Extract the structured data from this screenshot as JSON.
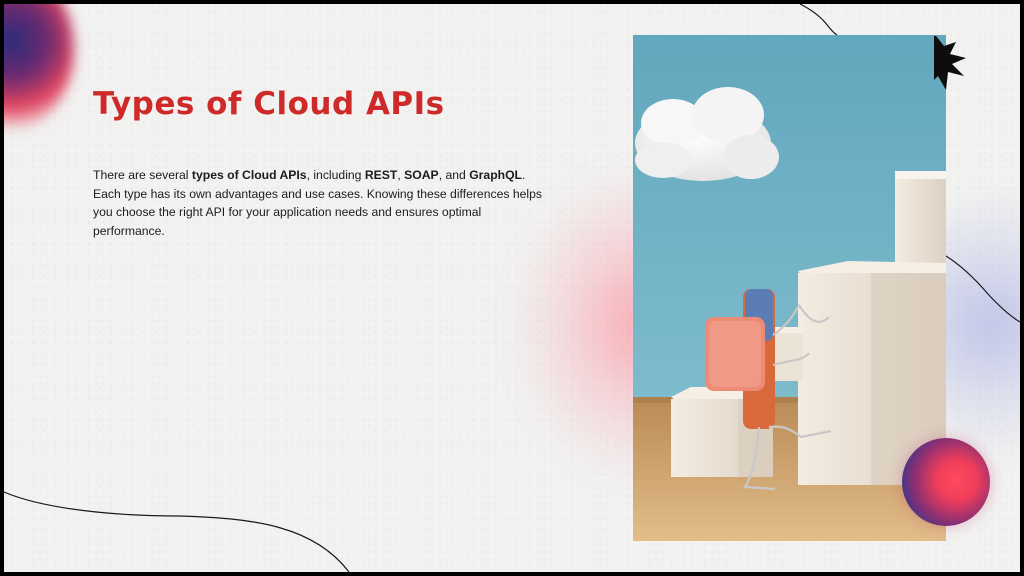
{
  "slide": {
    "title": "Types of Cloud APIs",
    "body": {
      "t1": "There are several ",
      "b1": "types of Cloud APIs",
      "t2": ", including ",
      "b2": "REST",
      "t3": ", ",
      "b3": "SOAP",
      "t4": ", and ",
      "b4": "GraphQL",
      "t5": ". Each type has its own advantages and use cases. Knowing these differences helps you choose the right API for your application needs and ensures optimal performance."
    }
  },
  "image": {
    "subject": "pencil-eraser-figure-climbing-white-boxes-with-cloud"
  },
  "decor": {
    "icons": [
      "starburst-icon",
      "gradient-orb-icon"
    ],
    "colors": {
      "title": "#cf2a2a",
      "background": "#f2f2f1",
      "frame": "#000000",
      "sky": "#6fb0c4",
      "orb_red": "#ff4a5c",
      "orb_blue": "#2b3a8f"
    }
  }
}
